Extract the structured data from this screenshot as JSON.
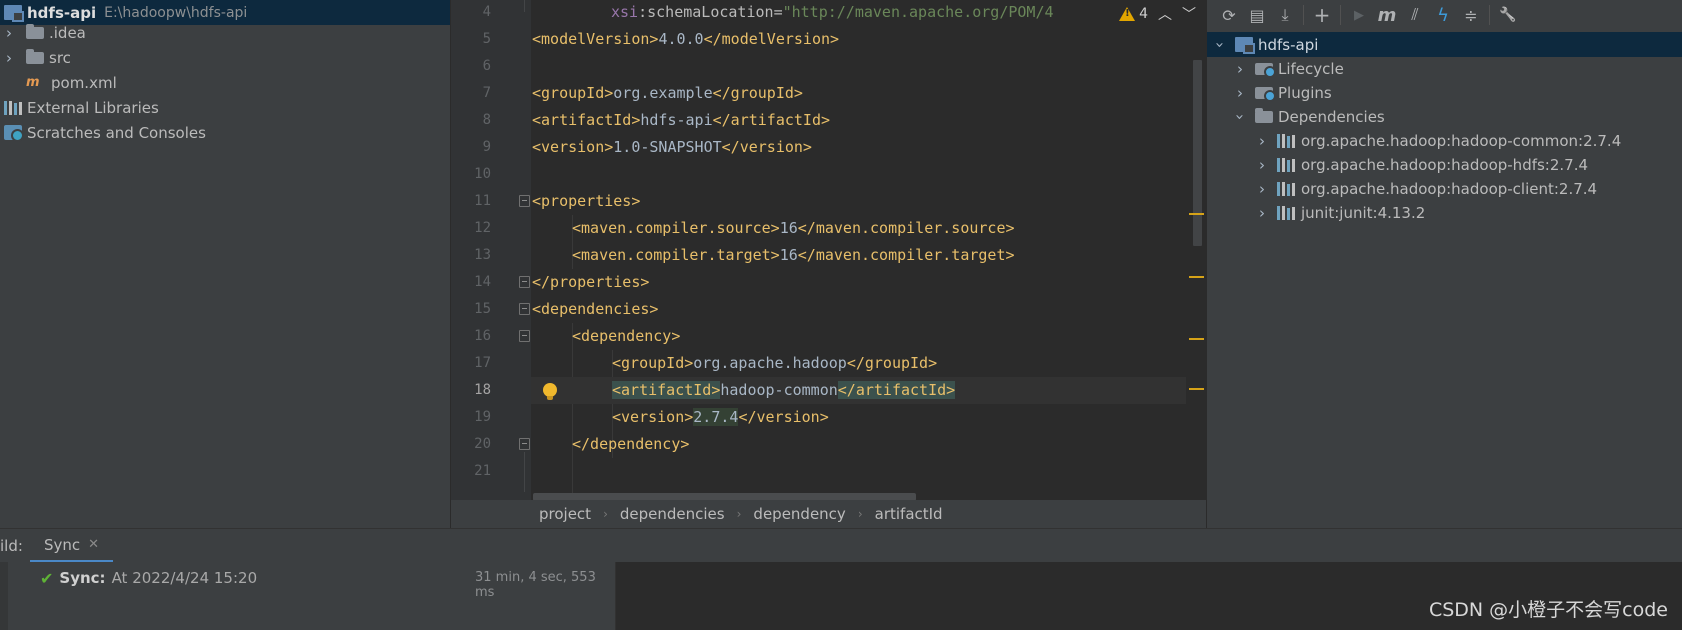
{
  "project_tree": {
    "root": {
      "name": "hdfs-api",
      "path": "E:\\hadoopw\\hdfs-api"
    },
    "items": [
      {
        "label": ".idea",
        "icon": "folder-icon"
      },
      {
        "label": "src",
        "icon": "folder-icon"
      },
      {
        "label": "pom.xml",
        "icon": "maven-xml-icon"
      },
      {
        "label": "External Libraries",
        "icon": "library-icon"
      },
      {
        "label": "Scratches and Consoles",
        "icon": "scratches-icon"
      }
    ]
  },
  "editor": {
    "inspection": {
      "warnings": "4"
    },
    "line_numbers": [
      "4",
      "5",
      "6",
      "7",
      "8",
      "9",
      "10",
      "11",
      "12",
      "13",
      "14",
      "15",
      "16",
      "17",
      "18",
      "19",
      "20",
      "21"
    ],
    "current_line": "18",
    "breadcrumbs": [
      "project",
      "dependencies",
      "dependency",
      "artifactId"
    ],
    "code": {
      "l4_prefix": "xsi",
      "l4_colon": ":",
      "l4_attr": "schemaLocation",
      "l4_eq": "=",
      "l4_value": "\"http://maven.apache.org/POM/4",
      "model_open": "<modelVersion>",
      "model_val": "4.0.0",
      "model_close": "</modelVersion>",
      "group_open": "<groupId>",
      "group_val": "org.example",
      "group_close": "</groupId>",
      "artifact_open": "<artifactId>",
      "artifact_val": "hdfs-api",
      "artifact_close": "</artifactId>",
      "version_open": "<version>",
      "version_val": "1.0-SNAPSHOT",
      "version_close": "</version>",
      "props_open": "<properties>",
      "src_open": "<maven.compiler.source>",
      "src_val": "16",
      "src_close": "</maven.compiler.source>",
      "tgt_open": "<maven.compiler.target>",
      "tgt_val": "16",
      "tgt_close": "</maven.compiler.target>",
      "props_close": "</properties>",
      "deps_open": "<dependencies>",
      "dep_open": "<dependency>",
      "dgroup_open": "<groupId>",
      "dgroup_val": "org.apache.hadoop",
      "dgroup_close": "</groupId>",
      "dart_open": "<artifactId>",
      "dart_val": "hadoop-common",
      "dart_close": "</artifactId>",
      "dver_open": "<version>",
      "dver_val": "2.7.4",
      "dver_close": "</version>",
      "dep_close": "</dependency>"
    }
  },
  "maven": {
    "toolbar": [
      {
        "name": "reload-icon",
        "glyph": "⟳"
      },
      {
        "name": "generate-sources-icon",
        "glyph": "▤"
      },
      {
        "name": "download-icon",
        "glyph": "⤓"
      },
      {
        "name": "add-icon",
        "glyph": "+"
      },
      {
        "name": "run-icon",
        "glyph": "▶"
      },
      {
        "name": "execute-goal-icon",
        "glyph": "m"
      },
      {
        "name": "toggle-offline-icon",
        "glyph": "⫽"
      },
      {
        "name": "skip-tests-icon",
        "glyph": "ϟ"
      },
      {
        "name": "collapse-all-icon",
        "glyph": "≑"
      },
      {
        "name": "settings-wrench-icon",
        "glyph": "🔧"
      }
    ],
    "root": "hdfs-api",
    "nodes": [
      "Lifecycle",
      "Plugins",
      "Dependencies"
    ],
    "dependencies": [
      "org.apache.hadoop:hadoop-common:2.7.4",
      "org.apache.hadoop:hadoop-hdfs:2.7.4",
      "org.apache.hadoop:hadoop-client:2.7.4",
      "junit:junit:4.13.2"
    ]
  },
  "build": {
    "label": "ild:",
    "tab": "Sync",
    "sync_title": "Sync:",
    "sync_detail": "At 2022/4/24 15:20",
    "duration": "31 min, 4 sec, 553 ms"
  },
  "watermark": "CSDN @小橙子不会写code",
  "colors": {
    "tag": "#e8bf6a",
    "text": "#a9b7c6",
    "string": "#6a8759",
    "selection": "#0d293e",
    "warning": "#e2a600",
    "success": "#5fb336"
  }
}
